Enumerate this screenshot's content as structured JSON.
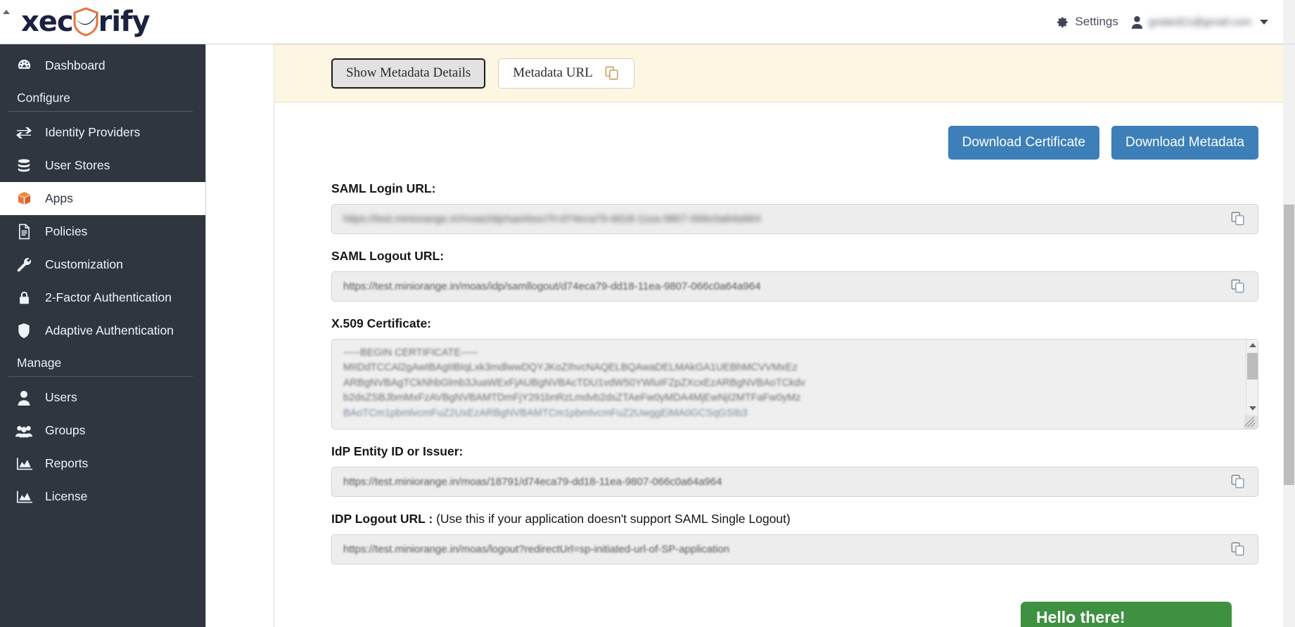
{
  "header": {
    "brand_prefix": "xec",
    "brand_suffix": "rify",
    "settings_label": "Settings",
    "user_email": "gnated21@gmail.com",
    "icons": {
      "gear": "gear-icon",
      "user": "user-icon",
      "caret": "chevron-down-icon"
    }
  },
  "sidebar": {
    "items": [
      {
        "label": "Dashboard",
        "icon": "dashboard-icon",
        "type": "item",
        "active": false
      },
      {
        "label": "Configure",
        "icon": "",
        "type": "section"
      },
      {
        "label": "Identity Providers",
        "icon": "exchange-icon",
        "type": "item",
        "active": false
      },
      {
        "label": "User Stores",
        "icon": "database-icon",
        "type": "item",
        "active": false
      },
      {
        "label": "Apps",
        "icon": "box-icon",
        "type": "item",
        "active": true
      },
      {
        "label": "Policies",
        "icon": "document-icon",
        "type": "item",
        "active": false
      },
      {
        "label": "Customization",
        "icon": "wrench-icon",
        "type": "item",
        "active": false
      },
      {
        "label": "2-Factor Authentication",
        "icon": "lock-icon",
        "type": "item",
        "active": false
      },
      {
        "label": "Adaptive Authentication",
        "icon": "shield-icon",
        "type": "item",
        "active": false
      },
      {
        "label": "Manage",
        "icon": "",
        "type": "section"
      },
      {
        "label": "Users",
        "icon": "user-icon",
        "type": "item",
        "active": false
      },
      {
        "label": "Groups",
        "icon": "users-icon",
        "type": "item",
        "active": false
      },
      {
        "label": "Reports",
        "icon": "chart-icon",
        "type": "item",
        "active": false
      },
      {
        "label": "License",
        "icon": "chart-icon",
        "type": "item",
        "active": false
      }
    ]
  },
  "main": {
    "metadata_bar": {
      "show_details_label": "Show Metadata Details",
      "metadata_url_label": "Metadata URL",
      "copy_icon": "copy-icon"
    },
    "download_buttons": [
      {
        "label": "Download Certificate",
        "name": "download-certificate-button"
      },
      {
        "label": "Download Metadata",
        "name": "download-metadata-button"
      }
    ],
    "fields": [
      {
        "label": "SAML Login URL:",
        "note": "",
        "value": "https://test.miniorange.in/moas/idp/samlsso?t=d74eca79-dd18-11ea-9807-066c0a64a964",
        "name": "saml-login-url"
      },
      {
        "label": "SAML Logout URL:",
        "note": "",
        "value": "https://test.miniorange.in/moas/idp/samllogout/d74eca79-dd18-11ea-9807-066c0a64a964",
        "name": "saml-logout-url"
      },
      {
        "label": "IdP Entity ID or Issuer:",
        "note": "",
        "value": "https://test.miniorange.in/moas/18791/d74eca79-dd18-11ea-9807-066c0a64a964",
        "name": "idp-entity-id"
      },
      {
        "label": "IDP Logout URL :",
        "note": " (Use this if your application doesn't support SAML Single Logout)",
        "value": "https://test.miniorange.in/moas/logout?redirectUrl=sp-initiated-url-of-SP-application",
        "name": "idp-logout-url"
      }
    ],
    "certificate": {
      "label": "X.509 Certificate:",
      "begin_line": "-----BEGIN CERTIFICATE-----",
      "body_lines": [
        "MIIDdTCCAl2gAwIBAgIIBIqLxk3mdlwwDQYJKoZIhvcNAQELBQAwaDELMAkGA1UEBhMCVVMxEz",
        "ARBgNVBAgTCkNhbGlmb3JuaWExFjAUBgNVBAcTDU1vdW50YWluIFZpZXcxEzARBgNVBAoTCkdv",
        "b2dsZSBJbmMxFzAVBgNVBAMTDmFjY291bnRzLmdvb2dsZTAeFw0yMDA4MjEwNjI2MTFaFw0yMz",
        "BAoTCm1pbmlvcmFuZ2UxEzARBgNVBAMTCm1pbmlvcmFuZ2UwggEiMA0GCSqGSIb3"
      ]
    },
    "scroll": {
      "indicator": "vertical-scrollbar"
    }
  },
  "chat": {
    "title": "Hello there!"
  },
  "colors": {
    "sidebar_bg": "#2f3640",
    "accent_blue": "#3c7fb9",
    "accent_orange": "#e8743b",
    "metadata_bg": "#fdf6e3",
    "chat_green": "#3f9142"
  }
}
